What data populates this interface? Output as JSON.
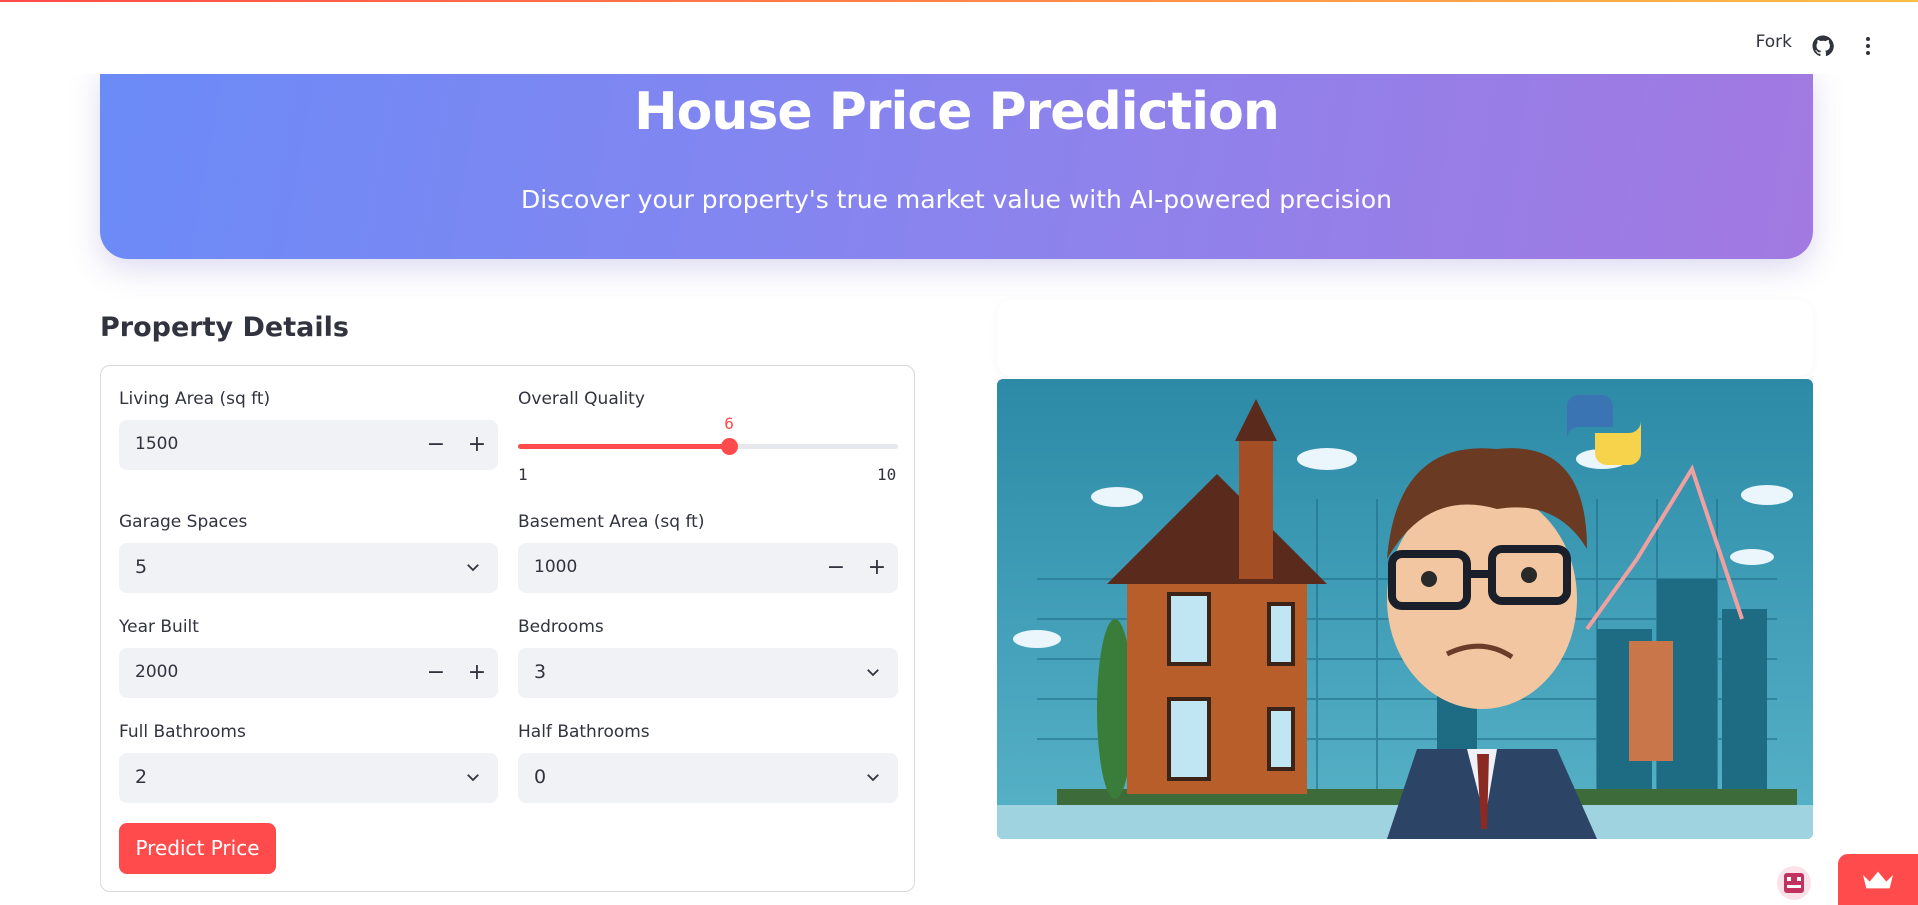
{
  "toolbar": {
    "fork_label": "Fork",
    "icons": [
      "github-icon",
      "more-vert-icon"
    ]
  },
  "hero": {
    "title": "House Price Prediction",
    "subtitle": "Discover your property's true market value with AI-powered precision"
  },
  "form": {
    "section_title": "Property Details",
    "living_area": {
      "label": "Living Area (sq ft)",
      "value": "1500"
    },
    "overall_quality": {
      "label": "Overall Quality",
      "value": "6",
      "min": "1",
      "max": "10",
      "fraction": 0.5556
    },
    "garage_spaces": {
      "label": "Garage Spaces",
      "value": "5"
    },
    "basement_area": {
      "label": "Basement Area (sq ft)",
      "value": "1000"
    },
    "year_built": {
      "label": "Year Built",
      "value": "2000"
    },
    "bedrooms": {
      "label": "Bedrooms",
      "value": "3"
    },
    "full_bathrooms": {
      "label": "Full Bathrooms",
      "value": "2"
    },
    "half_bathrooms": {
      "label": "Half Bathrooms",
      "value": "0"
    },
    "stepper_minus": "−",
    "stepper_plus": "+",
    "predict_label": "Predict Price"
  },
  "colors": {
    "accent": "#ff4b4b",
    "hero_start": "#6b8bf7",
    "hero_end": "#a279e1",
    "field_bg": "#f0f2f6"
  }
}
